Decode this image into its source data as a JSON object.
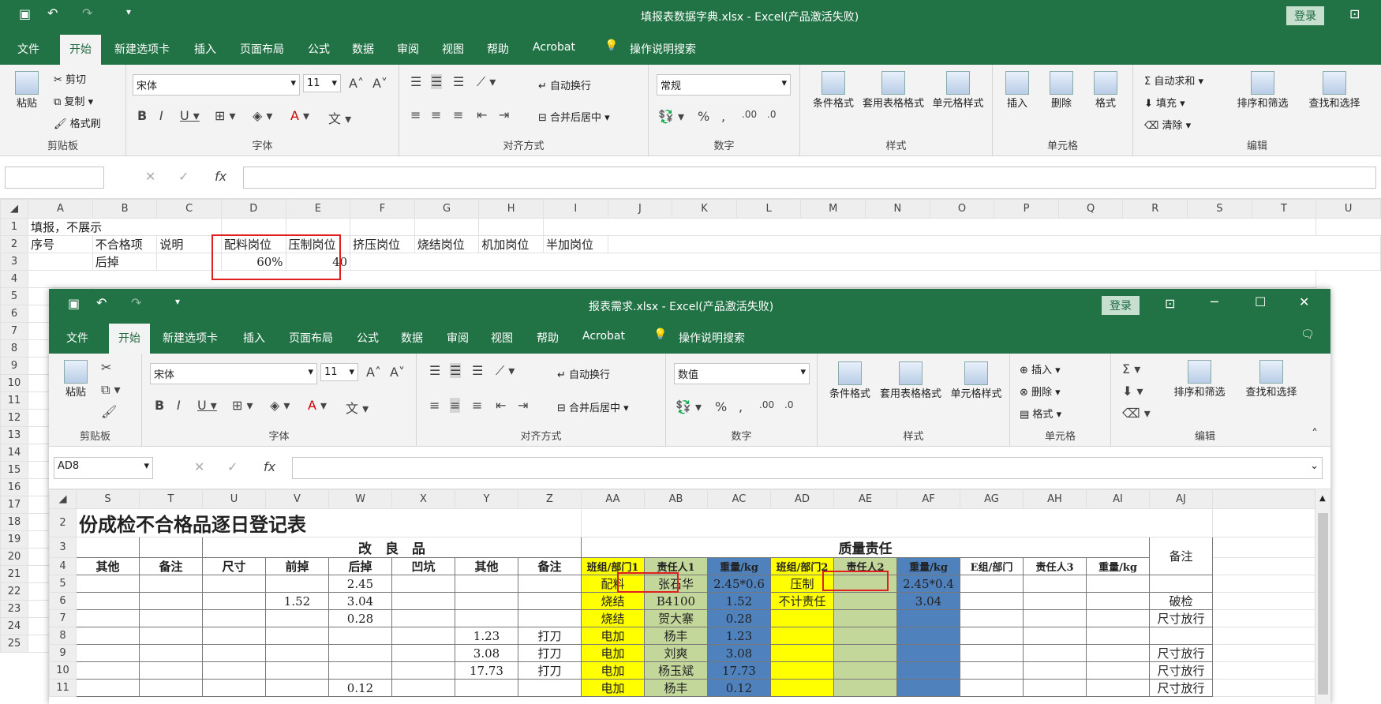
{
  "back": {
    "title": "填报表数据字典.xlsx  -  Excel(产品激活失败)",
    "login": "登录",
    "tabs": [
      "文件",
      "开始",
      "新建选项卡",
      "插入",
      "页面布局",
      "公式",
      "数据",
      "审阅",
      "视图",
      "帮助",
      "Acrobat"
    ],
    "tell_me": "操作说明搜索",
    "clipboard": {
      "paste": "粘贴",
      "cut": "剪切",
      "copy": "复制",
      "painter": "格式刷",
      "label": "剪贴板"
    },
    "font": {
      "name": "宋体",
      "size": "11",
      "label": "字体"
    },
    "align": {
      "wrap": "自动换行",
      "merge": "合并后居中",
      "label": "对齐方式"
    },
    "number": {
      "format": "常规",
      "label": "数字"
    },
    "styles": {
      "cond": "条件格式",
      "table": "套用表格格式",
      "cell": "单元格样式",
      "label": "样式"
    },
    "cells": {
      "insert": "插入",
      "delete": "删除",
      "format": "格式",
      "label": "单元格"
    },
    "editing": {
      "autosum": "自动求和",
      "fill": "填充",
      "clear": "清除",
      "sort": "排序和筛选",
      "find": "查找和选择",
      "label": "编辑"
    },
    "name_box": "",
    "fx": "fx",
    "columns": [
      "A",
      "B",
      "C",
      "D",
      "E",
      "F",
      "G",
      "H",
      "I",
      "J",
      "K",
      "L",
      "M",
      "N",
      "O",
      "P",
      "Q",
      "R",
      "S",
      "T",
      "U"
    ],
    "rows": [
      "1",
      "2",
      "3",
      "4",
      "5",
      "6",
      "7",
      "8",
      "9",
      "10",
      "11",
      "12",
      "13",
      "14",
      "15",
      "16",
      "17",
      "18",
      "19",
      "20",
      "21",
      "22",
      "23",
      "24",
      "25"
    ],
    "cells_data": {
      "A1": "填报，不展示",
      "A2": "序号",
      "B2": "不合格项",
      "C2": "说明",
      "D2": "配料岗位",
      "E2": "压制岗位",
      "F2": "挤压岗位",
      "G2": "烧结岗位",
      "H2": "机加岗位",
      "I2": "半加岗位",
      "B3": "后掉",
      "D3": "60%",
      "E3": "40"
    }
  },
  "front": {
    "title": "报表需求.xlsx  -  Excel(产品激活失败)",
    "login": "登录",
    "tabs": [
      "文件",
      "开始",
      "新建选项卡",
      "插入",
      "页面布局",
      "公式",
      "数据",
      "审阅",
      "视图",
      "帮助",
      "Acrobat"
    ],
    "tell_me": "操作说明搜索",
    "clipboard": {
      "paste": "粘贴",
      "label": "剪贴板"
    },
    "font": {
      "name": "宋体",
      "size": "11",
      "label": "字体"
    },
    "align": {
      "wrap": "自动换行",
      "merge": "合并后居中",
      "label": "对齐方式"
    },
    "number": {
      "format": "数值",
      "label": "数字"
    },
    "styles": {
      "cond": "条件格式",
      "table": "套用表格格式",
      "cell": "单元格样式",
      "label": "样式"
    },
    "cells": {
      "insert": "插入",
      "delete": "删除",
      "format": "格式",
      "label": "单元格"
    },
    "editing": {
      "sort": "排序和筛选",
      "find": "查找和选择",
      "label": "编辑"
    },
    "name_box": "AD8",
    "fx": "fx",
    "columns": [
      "S",
      "T",
      "U",
      "V",
      "W",
      "X",
      "Y",
      "Z",
      "AA",
      "AB",
      "AC",
      "AD",
      "AE",
      "AF",
      "AG",
      "AH",
      "AI",
      "AJ"
    ],
    "sheet": {
      "title": "份成检不合格品逐日登记表",
      "gailiang": "改　良　品",
      "zhiliang": "质量责任",
      "beizhu": "备注",
      "headers": [
        "其他",
        "备注",
        "尺寸",
        "前掉",
        "后掉",
        "凹坑",
        "其他",
        "备注",
        "班组/部门1",
        "责任人1",
        "重量/kg",
        "班组/部门2",
        "责任人2",
        "重量/kg",
        "E组/部门",
        "责任人3",
        "重量/kg"
      ],
      "rows": [
        {
          "n": "5",
          "W": "2.45",
          "AA": "配料",
          "AB": "张石华",
          "AC": "2.45*0.6",
          "AD": "压制",
          "AF": "2.45*0.4"
        },
        {
          "n": "6",
          "V": "1.52",
          "W": "3.04",
          "AA": "烧结",
          "AB": "B4100",
          "AC": "1.52",
          "AD": "不计责任",
          "AF": "3.04",
          "AJ": "破检"
        },
        {
          "n": "7",
          "W": "0.28",
          "AA": "烧结",
          "AB": "贺大寨",
          "AC": "0.28",
          "AJ": "尺寸放行"
        },
        {
          "n": "8",
          "Y": "1.23",
          "Z": "打刀",
          "AA": "电加",
          "AB": "杨丰",
          "AC": "1.23"
        },
        {
          "n": "9",
          "Y": "3.08",
          "Z": "打刀",
          "AA": "电加",
          "AB": "刘爽",
          "AC": "3.08",
          "AJ": "尺寸放行"
        },
        {
          "n": "10",
          "Y": "17.73",
          "Z": "打刀",
          "AA": "电加",
          "AB": "杨玉斌",
          "AC": "17.73",
          "AJ": "尺寸放行"
        },
        {
          "n": "11",
          "W": "0.12",
          "AA": "电加",
          "AB": "杨丰",
          "AC": "0.12",
          "AJ": "尺寸放行"
        }
      ]
    }
  }
}
